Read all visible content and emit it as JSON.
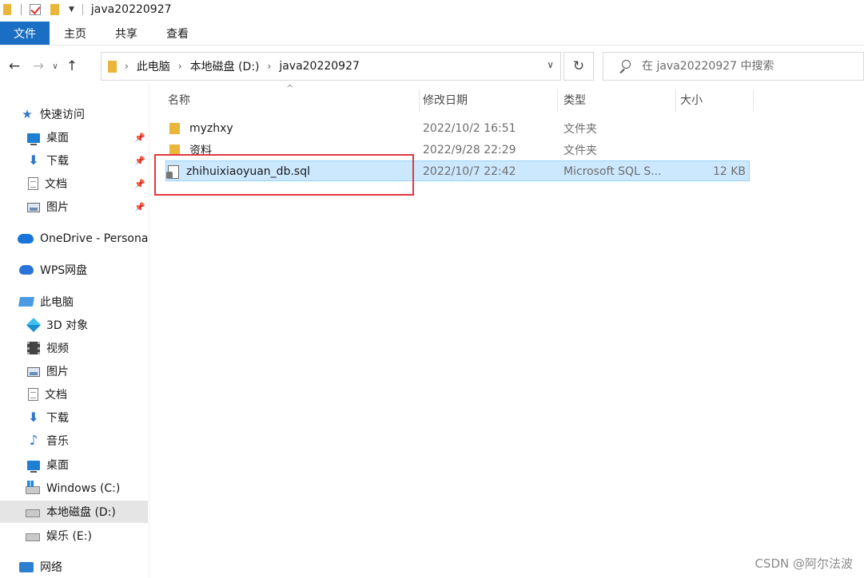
{
  "window": {
    "title": "java20220927"
  },
  "ribbon": {
    "tabs": [
      "文件",
      "主页",
      "共享",
      "查看"
    ]
  },
  "nav": {
    "breadcrumbs": [
      "此电脑",
      "本地磁盘 (D:)",
      "java20220927"
    ],
    "search_placeholder": "在 java20220927 中搜索"
  },
  "sidebar": {
    "items": [
      {
        "label": "快速访问",
        "icon": "star-icon"
      },
      {
        "label": "桌面",
        "icon": "desktop-icon",
        "pinned": true
      },
      {
        "label": "下载",
        "icon": "download-icon",
        "pinned": true
      },
      {
        "label": "文档",
        "icon": "document-icon",
        "pinned": true
      },
      {
        "label": "图片",
        "icon": "picture-icon",
        "pinned": true
      },
      {
        "label": "OneDrive - Persona",
        "icon": "onedrive-icon"
      },
      {
        "label": "WPS网盘",
        "icon": "wps-cloud-icon"
      },
      {
        "label": "此电脑",
        "icon": "computer-icon"
      },
      {
        "label": "3D 对象",
        "icon": "3d-objects-icon"
      },
      {
        "label": "视频",
        "icon": "video-icon"
      },
      {
        "label": "图片",
        "icon": "picture-icon"
      },
      {
        "label": "文档",
        "icon": "document-icon"
      },
      {
        "label": "下载",
        "icon": "download-icon"
      },
      {
        "label": "音乐",
        "icon": "music-icon"
      },
      {
        "label": "桌面",
        "icon": "desktop-icon"
      },
      {
        "label": "Windows (C:)",
        "icon": "windows-drive-icon"
      },
      {
        "label": "本地磁盘 (D:)",
        "icon": "drive-icon",
        "selected": true
      },
      {
        "label": "娱乐 (E:)",
        "icon": "drive-icon"
      },
      {
        "label": "网络",
        "icon": "network-icon"
      }
    ]
  },
  "filelist": {
    "columns": [
      "名称",
      "修改日期",
      "类型",
      "大小"
    ],
    "rows": [
      {
        "name": "myzhxy",
        "modified": "2022/10/2 16:51",
        "type": "文件夹",
        "size": "",
        "icon": "folder-icon"
      },
      {
        "name": "资料",
        "modified": "2022/9/28 22:29",
        "type": "文件夹",
        "size": "",
        "icon": "folder-icon"
      },
      {
        "name": "zhihuixiaoyuan_db.sql",
        "modified": "2022/10/7 22:42",
        "type": "Microsoft SQL S...",
        "size": "12 KB",
        "icon": "sql-file-icon",
        "selected": true
      }
    ]
  },
  "watermark": "CSDN @阿尔法波",
  "colors": {
    "accent": "#1a6fc4",
    "selection": "#cce8ff",
    "highlight_box": "#e0393e"
  }
}
